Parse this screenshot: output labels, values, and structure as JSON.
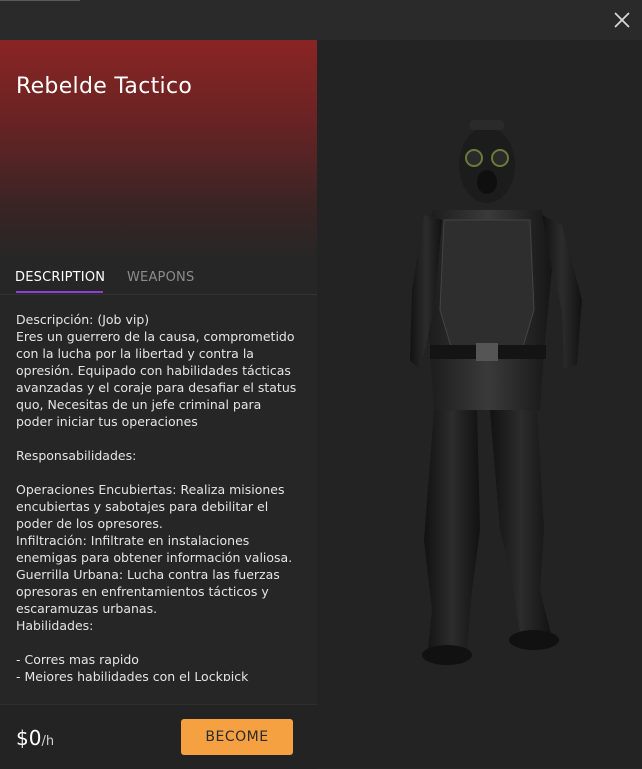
{
  "job": {
    "title": "Rebelde Tactico",
    "accent_color": "#8a2424"
  },
  "tabs": [
    {
      "label": "DESCRIPTION",
      "active": true
    },
    {
      "label": "WEAPONS",
      "active": false
    }
  ],
  "description": "Descripción: (Job vip)\nEres un guerrero de la causa, comprometido con la lucha por la libertad y contra la opresión. Equipado con habilidades tácticas avanzadas y el coraje para desafiar el status quo, Necesitas de un jefe criminal para poder iniciar tus operaciones\n\nResponsabilidades:\n\nOperaciones Encubiertas: Realiza misiones encubiertas y sabotajes para debilitar el poder de los opresores.\nInfiltración: Infiltrate en instalaciones enemigas para obtener información valiosa.\nGuerrilla Urbana: Lucha contra las fuerzas opresoras en enfrentamientos tácticos y escaramuzas urbanas.\nHabilidades:\n\n- Corres mas rapido\n- Mejores habilidades con el Lockpick",
  "footer": {
    "price": "$0",
    "unit": "/h",
    "become_label": "BECOME",
    "button_color": "#f5a142"
  },
  "icons": {
    "close": "close-icon"
  }
}
